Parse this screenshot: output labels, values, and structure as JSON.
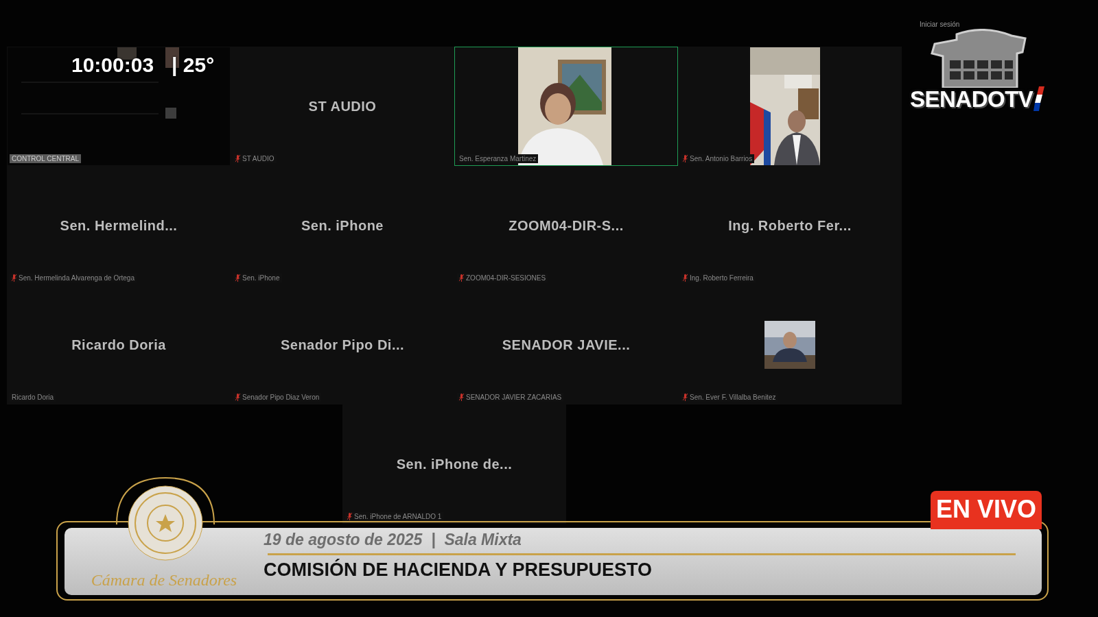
{
  "clock": {
    "time": "10:00:03",
    "temperature": "| 25°"
  },
  "login_link": "Iniciar sesión",
  "channel_logo": {
    "text": "SENADOTV"
  },
  "tiles": [
    {
      "kind": "thumbnail",
      "label": "CONTROL CENTRAL",
      "mic_muted": false,
      "active_speaker": false
    },
    {
      "kind": "name",
      "display": "ST AUDIO",
      "label": "ST AUDIO",
      "mic_muted": true,
      "active_speaker": false
    },
    {
      "kind": "video",
      "label": "Sen. Esperanza Martinez",
      "mic_muted": false,
      "active_speaker": true
    },
    {
      "kind": "video",
      "label": "Sen. Antonio Barrios",
      "mic_muted": true,
      "active_speaker": false
    },
    {
      "kind": "name",
      "display": "Sen. Hermelind...",
      "label": "Sen. Hermelinda Alvarenga de Ortega",
      "mic_muted": true,
      "active_speaker": false
    },
    {
      "kind": "name",
      "display": "Sen. iPhone",
      "label": "Sen. iPhone",
      "mic_muted": true,
      "active_speaker": false
    },
    {
      "kind": "name",
      "display": "ZOOM04-DIR-S...",
      "label": "ZOOM04-DIR-SESIONES",
      "mic_muted": true,
      "active_speaker": false
    },
    {
      "kind": "name",
      "display": "Ing. Roberto Fer...",
      "label": "Ing. Roberto Ferreira",
      "mic_muted": true,
      "active_speaker": false
    },
    {
      "kind": "name",
      "display": "Ricardo Doria",
      "label": "Ricardo Doria",
      "mic_muted": false,
      "active_speaker": false
    },
    {
      "kind": "name",
      "display": "Senador Pipo Di...",
      "label": "Senador Pipo Diaz Veron",
      "mic_muted": true,
      "active_speaker": false
    },
    {
      "kind": "name",
      "display": "SENADOR JAVIE...",
      "label": "SENADOR JAVIER ZACARIAS",
      "mic_muted": true,
      "active_speaker": false
    },
    {
      "kind": "avatar",
      "label": "Sen. Ever F. Villalba Benitez",
      "mic_muted": true,
      "active_speaker": false
    },
    {
      "kind": "name",
      "display": "Sen. iPhone de...",
      "label": "Sen. iPhone de ARNALDO 1",
      "mic_muted": true,
      "active_speaker": false
    }
  ],
  "lower_third": {
    "institution": "Cámara de Senadores",
    "live_badge": "EN VIVO",
    "date_place": "19 de agosto de 2025  |  Sala Mixta",
    "title": "COMISIÓN DE HACIENDA Y PRESUPUESTO"
  }
}
